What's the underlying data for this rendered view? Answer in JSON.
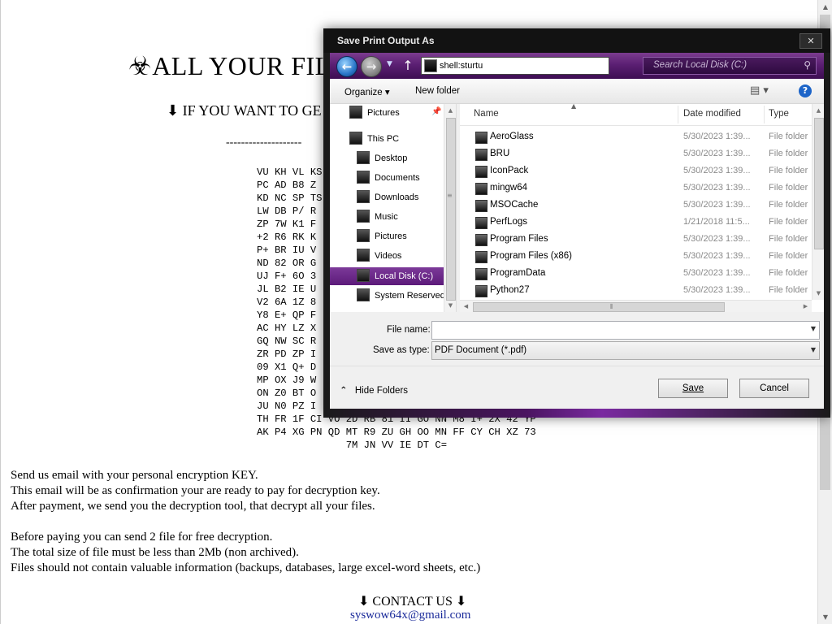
{
  "page": {
    "title": "☣ALL YOUR FIL",
    "subtitle": "⬇ IF YOU WANT TO GE",
    "dashes": "--------------------",
    "key_lines": [
      "VU KH VL KS",
      "PC AD B8 Z",
      "KD NC SP TS",
      "LW DB P/ R",
      "ZP 7W K1 F",
      "+2 R6 RK K",
      "P+ BR IU V",
      "ND 82 OR G",
      "UJ F+ 6O 3",
      "JL B2 IE U",
      "V2 6A 1Z 8",
      "Y8 E+ QP F",
      "AC HY LZ X",
      "GQ NW SC R",
      "ZR PD ZP I",
      "09 X1 Q+ D",
      "MP OX J9 W",
      "ON Z0 BT O",
      "JU N0 PZ I",
      "TH FR 1F CI VO 2D RB 81 II GO NN M8 I+ 2X 42 YP",
      "AK P4 XG PN QD MT R9 ZU GH OO MN FF CY CH XZ 73",
      "               7M JN VV IE DT C="
    ],
    "message_lines": [
      "Send us email with your personal encryption KEY.",
      "This email will be as confirmation your are ready to pay for decryption key.",
      "After payment, we send you the decryption tool, that decrypt all your files.",
      "",
      "Before paying you can send 2 file for free decryption.",
      "The total size of file must be less than 2Mb (non archived).",
      "Files should not contain valuable information (backups, databases, large excel-word sheets, etc.)"
    ],
    "contact_heading": "⬇ CONTACT US ⬇",
    "contact_email": "syswow64x@gmail.com"
  },
  "dialog": {
    "title": "Save Print Output As",
    "close_glyph": "✕",
    "address_value": "shell:sturtu",
    "search_placeholder": "Search Local Disk (C:)",
    "toolbar": {
      "organize": "Organize ▾",
      "new_folder": "New folder",
      "help": "?"
    },
    "nav": [
      {
        "label": "Pictures",
        "icon": "pictures-icon"
      },
      {
        "label": "This PC",
        "icon": "this-pc-icon"
      },
      {
        "label": "Desktop",
        "icon": "desktop-icon"
      },
      {
        "label": "Documents",
        "icon": "documents-icon"
      },
      {
        "label": "Downloads",
        "icon": "downloads-icon"
      },
      {
        "label": "Music",
        "icon": "music-icon"
      },
      {
        "label": "Pictures",
        "icon": "pictures-icon"
      },
      {
        "label": "Videos",
        "icon": "videos-icon"
      },
      {
        "label": "Local Disk (C:)",
        "icon": "drive-icon",
        "selected": true
      },
      {
        "label": "System Reserved",
        "icon": "drive-icon"
      }
    ],
    "columns": {
      "name": "Name",
      "date": "Date modified",
      "type": "Type"
    },
    "files": [
      {
        "name": "AeroGlass",
        "date": "5/30/2023 1:39...",
        "type": "File folder"
      },
      {
        "name": "BRU",
        "date": "5/30/2023 1:39...",
        "type": "File folder"
      },
      {
        "name": "IconPack",
        "date": "5/30/2023 1:39...",
        "type": "File folder"
      },
      {
        "name": "mingw64",
        "date": "5/30/2023 1:39...",
        "type": "File folder"
      },
      {
        "name": "MSOCache",
        "date": "5/30/2023 1:39...",
        "type": "File folder"
      },
      {
        "name": "PerfLogs",
        "date": "1/21/2018 11:5...",
        "type": "File folder"
      },
      {
        "name": "Program Files",
        "date": "5/30/2023 1:39...",
        "type": "File folder"
      },
      {
        "name": "Program Files (x86)",
        "date": "5/30/2023 1:39...",
        "type": "File folder"
      },
      {
        "name": "ProgramData",
        "date": "5/30/2023 1:39...",
        "type": "File folder"
      },
      {
        "name": "Python27",
        "date": "5/30/2023 1:39...",
        "type": "File folder"
      }
    ],
    "form": {
      "file_name_label": "File name:",
      "file_name_value": "",
      "save_type_label": "Save as type:",
      "save_type_value": "PDF Document (*.pdf)",
      "hide_folders": "Hide Folders",
      "save": "Save",
      "cancel": "Cancel"
    }
  },
  "colors": {
    "accent": "#6a2a8a",
    "selection": "#7c3a99",
    "email_link": "#1a2a9a"
  }
}
